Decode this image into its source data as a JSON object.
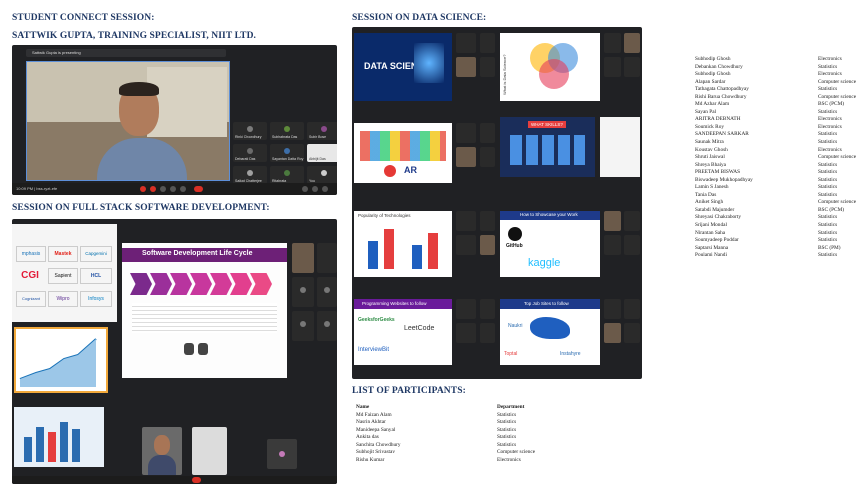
{
  "headings": {
    "student_connect": "STUDENT CONNECT SESSION:",
    "speaker": "SATTWIK GUPTA, TRAINING SPECIALIST, NIIT LTD.",
    "full_stack": "SESSION ON FULL STACK SOFTWARE DEVELOPMENT:",
    "data_science": "SESSION ON DATA SCIENCE:",
    "participants": "LIST OF PARTICIPANTS:"
  },
  "meet_top": {
    "banner": "Sattwik Gupta is presenting",
    "tiles": [
      "Rinki Chowdhury",
      "Subhabrata Das",
      "Subir Bose",
      "Debarati Das",
      "Sayantan Datta Roy",
      "Abhijit Das",
      "Saikat Chatterjee",
      "Ritabrata",
      "You"
    ],
    "time_text": "10:09 PM | bss-ryzt-efe"
  },
  "meet_fs": {
    "slide_title": "Software Development Life Cycle",
    "logos": [
      "mphasis",
      "Mastek",
      "Capgemini",
      "CGI",
      "Sapient",
      "HCL",
      "Cognizant",
      "Wipro",
      "Infosys"
    ]
  },
  "meet_ds": {
    "slide1": "DATA SCIENCE",
    "slide2": "What is Data Science?",
    "slide4": "WHAT SKILLS?",
    "slide5": "Popularity of Technologies",
    "slide6": "How to Showcase your Work",
    "slide6_logos": [
      "GitHub",
      "kaggle"
    ],
    "slide7": "Programming Websites to follow",
    "slide7_logos": [
      "GeeksforGeeks",
      "LeetCode",
      "InterviewBit"
    ],
    "slide8": "Top Job Sites to follow",
    "slide8_logos": [
      "Naukri",
      "Toptal",
      "Instahyre"
    ]
  },
  "participants_bottom": {
    "header": [
      "Name",
      "Department"
    ],
    "rows": [
      [
        "Md Faizan Alam",
        "Statistics"
      ],
      [
        "Nasrin Akhtar",
        "Statistics"
      ],
      [
        "Manideepa Sanyal",
        "Statistics"
      ],
      [
        "Ankita das",
        "Statistics"
      ],
      [
        "Sanchita Chowdhury",
        "Statistics"
      ],
      [
        "Subhojit Srivastav",
        "Computer science"
      ],
      [
        "Rishu Kumar",
        "Electronics"
      ]
    ]
  },
  "participants_right": [
    [
      "Subhodip Ghosh",
      "Electronics"
    ],
    [
      "Debankan Chowdhury",
      "Statistics"
    ],
    [
      "Subhodip Ghosh",
      "Electronics"
    ],
    [
      "Alapan Sardar",
      "Computer science"
    ],
    [
      "Tathagata Chattopadhyay",
      "Statistics"
    ],
    [
      "Rishi Barua Chowdhury",
      "Computer science"
    ],
    [
      "Md Azhar Alam",
      "BSC (PCM)"
    ],
    [
      "Sayan Pal",
      "Statistics"
    ],
    [
      "ARITRA DEBNATH",
      "Electronics"
    ],
    [
      "Soumick Roy",
      "Electronics"
    ],
    [
      "SANDEEPAN SARKAR",
      "Statistics"
    ],
    [
      "Saunak Mitra",
      "Statistics"
    ],
    [
      "Koustav Ghosh",
      "Electronics"
    ],
    [
      "Shruti Jaiswal",
      "Computer science"
    ],
    [
      "Shreya Bhaiya",
      "Statistics"
    ],
    [
      "PREETAM BISWAS",
      "Statistics"
    ],
    [
      "Biswadeep Mukhopadhyay",
      "Statistics"
    ],
    [
      "Lamin S Janesh",
      "Statistics"
    ],
    [
      "Tania Das",
      "Statistics"
    ],
    [
      "Aniket Singh",
      "Computer science"
    ],
    [
      "Satabdi Majumder",
      "BSC (PCM)"
    ],
    [
      "Shreyasi Chakraborty",
      "Statistics"
    ],
    [
      "Srijani Mondal",
      "Statistics"
    ],
    [
      "Nirantan Saha",
      "Statistics"
    ],
    [
      "Soumyadeep Poddar",
      "Statistics"
    ],
    [
      "Saptarsi Manna",
      "BSC (PM)"
    ],
    [
      "Poulami Nandi",
      "Statistics"
    ]
  ]
}
